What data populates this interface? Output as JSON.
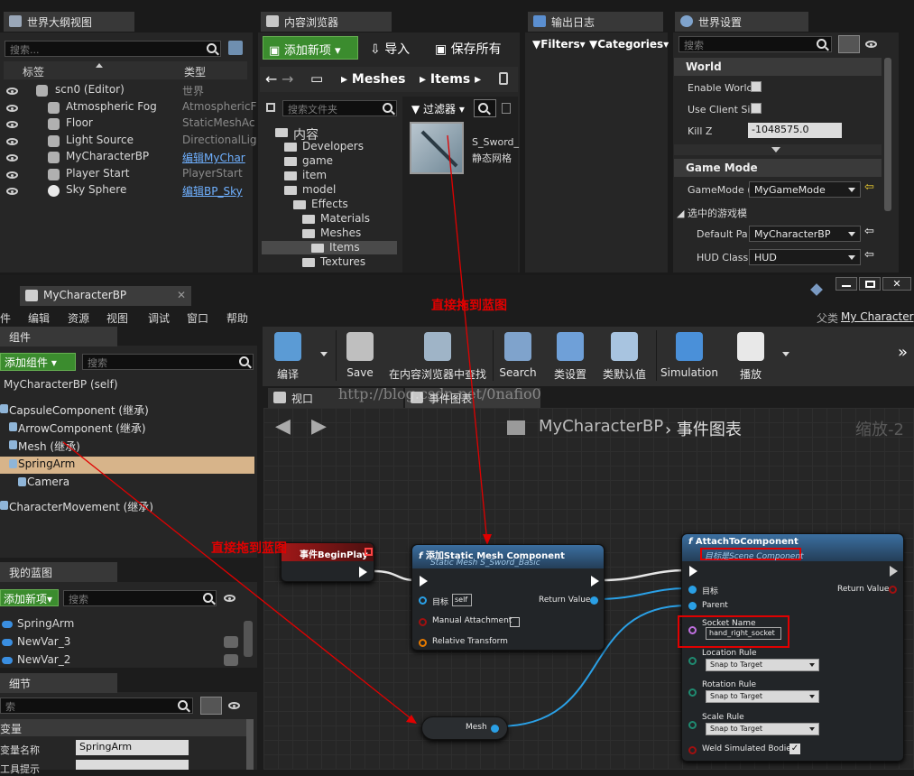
{
  "outliner": {
    "tab": "世界大纲视图",
    "search_placeholder": "搜索...",
    "col_label": "标签",
    "col_type": "类型",
    "rows": [
      {
        "label": "scn0 (Editor)",
        "type": "世界",
        "link": false
      },
      {
        "label": "Atmospheric Fog",
        "type": "AtmosphericF",
        "link": false
      },
      {
        "label": "Floor",
        "type": "StaticMeshAc",
        "link": false
      },
      {
        "label": "Light Source",
        "type": "DirectionalLig",
        "link": false
      },
      {
        "label": "MyCharacterBP",
        "type": "编辑MyChar",
        "link": true
      },
      {
        "label": "Player Start",
        "type": "PlayerStart",
        "link": false
      },
      {
        "label": "Sky Sphere",
        "type": "编辑BP_Sky",
        "link": true
      }
    ]
  },
  "content_browser": {
    "tab": "内容浏览器",
    "add_new": "添加新项",
    "import": "导入",
    "save_all": "保存所有",
    "path": [
      "Meshes",
      "Items"
    ],
    "folder_search": "搜索文件夹",
    "filter": "过滤器",
    "tree": [
      {
        "label": "内容",
        "indent": 0
      },
      {
        "label": "Developers",
        "indent": 1
      },
      {
        "label": "game",
        "indent": 1
      },
      {
        "label": "item",
        "indent": 1
      },
      {
        "label": "model",
        "indent": 1
      },
      {
        "label": "Effects",
        "indent": 2
      },
      {
        "label": "Materials",
        "indent": 3
      },
      {
        "label": "Meshes",
        "indent": 3
      },
      {
        "label": "Items",
        "indent": 4,
        "selected": true
      },
      {
        "label": "Textures",
        "indent": 3
      }
    ],
    "asset_name": "S_Sword_",
    "asset_type": "静态网格"
  },
  "output_log": {
    "tab": "输出日志",
    "filters": "Filters",
    "categories": "Categories"
  },
  "world_settings": {
    "tab": "世界设置",
    "search_placeholder": "搜索",
    "world_section": "World",
    "enable_world": "Enable World",
    "use_client": "Use Client Si",
    "kill_z_label": "Kill Z",
    "kill_z_value": "-1048575.0",
    "game_mode_section": "Game Mode",
    "gamemode_label": "GameMode (",
    "gamemode_value": "MyGameMode",
    "selected_game": "选中的游戏模",
    "default_pawn_label": "Default Pa",
    "default_pawn_value": "MyCharacterBP",
    "hud_label": "HUD Class",
    "hud_value": "HUD"
  },
  "bp_editor": {
    "tab": "MyCharacterBP",
    "parent_label": "父类",
    "parent_value": "My Character",
    "menu": [
      "件",
      "编辑",
      "资源",
      "视图",
      "调试",
      "窗口",
      "帮助"
    ],
    "toolbar": [
      "编译",
      "Save",
      "在内容浏览器中查找",
      "Search",
      "类设置",
      "类默认值",
      "Simulation",
      "播放"
    ],
    "components_tab": "组件",
    "add_component": "添加组件",
    "comp_search": "搜索",
    "self_label": "MyCharacterBP (self)",
    "components": [
      "CapsuleComponent (继承)",
      "ArrowComponent (继承)",
      "Mesh (继承)",
      "SpringArm",
      "Camera",
      "CharacterMovement (继承)"
    ],
    "my_bp_tab": "我的蓝图",
    "add_new": "添加新项",
    "bp_search": "搜索",
    "variables": [
      "SpringArm",
      "NewVar_3",
      "NewVar_2"
    ],
    "details_tab": "细节",
    "details_search": "索",
    "var_section": "变量",
    "var_name_label": "变量名称",
    "var_name_value": "SpringArm",
    "tooltip_label": "工具提示",
    "viewport_tab": "视口",
    "graph_tab": "事件图表",
    "breadcrumb_bp": "MyCharacterBP",
    "breadcrumb_graph": "事件图表",
    "zoom": "缩放-2",
    "watermark": "http://blog.csdn.net/0nafio0"
  },
  "nodes": {
    "begin_play": "事件BeginPlay",
    "add_mesh": {
      "title": "添加Static Mesh Component",
      "subtitle": "Static Mesh S_Sword_Basic",
      "target": "目标",
      "self": "self",
      "manual": "Manual Attachment",
      "relative": "Relative Transform",
      "return": "Return Value"
    },
    "attach": {
      "title": "AttachToComponent",
      "subtitle": "目标是Scene Component",
      "target": "目标",
      "parent": "Parent",
      "socket_label": "Socket Name",
      "socket_value": "hand_right_socket",
      "location_rule": "Location Rule",
      "rotation_rule": "Rotation Rule",
      "scale_rule": "Scale Rule",
      "snap": "Snap to Target",
      "weld": "Weld Simulated Bodies",
      "return": "Return Value"
    },
    "mesh": "Mesh"
  },
  "annotations": {
    "drag1": "直接拖到蓝图",
    "drag2": "直接拖到蓝图"
  }
}
